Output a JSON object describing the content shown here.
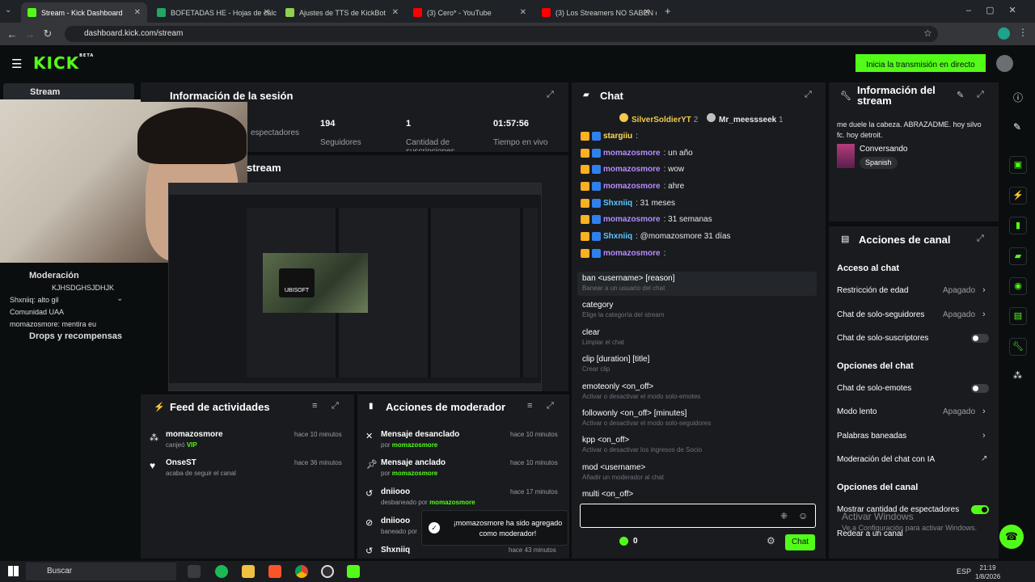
{
  "browser": {
    "tabs": [
      "Stream - Kick Dashboard",
      "BOFETADAS HE - Hojas de cálc",
      "Ajustes de TTS de KickBot",
      "(3) Cero* - YouTube",
      "(3) Los Streamers NO SABEN d"
    ],
    "url": "dashboard.kick.com/stream"
  },
  "header": {
    "logo": "KICK",
    "logo_beta": "BETA",
    "go_live": "Inicia la transmisión en directo"
  },
  "sidebar": {
    "stream": "Stream",
    "chat_lines": [
      "Moderación",
      "KJHSDGHSJDHJK",
      "Shxniiq: alto gil",
      "Comunidad UAA",
      "momazosmore: mentira eu",
      "Drops y recompensas"
    ]
  },
  "session": {
    "title": "Información de la sesión",
    "stats": [
      {
        "value": "",
        "label": "espectadores"
      },
      {
        "value": "194",
        "label": "Seguidores"
      },
      {
        "value": "1",
        "label": "Cantidad de suscripciones"
      },
      {
        "value": "01:57:56",
        "label": "Tiempo en vivo"
      }
    ],
    "preview_title": "stream"
  },
  "feed": {
    "title": "Feed de actividades",
    "items": [
      {
        "user": "momazosmore",
        "action": "canjeó",
        "extra": "VIP",
        "time": "hace 10 minutos"
      },
      {
        "user": "OnseST",
        "action": "acaba de seguir el canal",
        "extra": "",
        "time": "hace 36 minutos"
      }
    ]
  },
  "modactions": {
    "title": "Acciones de moderador",
    "items": [
      {
        "title": "Mensaje desanclado",
        "by": "por",
        "mod": "momazosmore",
        "time": "hace 10 minutos"
      },
      {
        "title": "Mensaje anclado",
        "by": "por",
        "mod": "momazosmore",
        "time": "hace 10 minutos"
      },
      {
        "title": "dniiooo",
        "by": "desbaneado por",
        "mod": "momazosmore",
        "time": "hace 17 minutos"
      },
      {
        "title": "dniiooo",
        "by": "baneado por",
        "mod": "",
        "time": ""
      },
      {
        "title": "Shxniiq",
        "by": "",
        "mod": "",
        "time": "hace 43 minutos"
      }
    ]
  },
  "toast": "¡momazosmore ha sido agregado como moderador!",
  "chat": {
    "title": "Chat",
    "top": [
      {
        "name": "SilverSoldierYT",
        "n": "2"
      },
      {
        "name": "Mr_meessseek",
        "n": "1"
      }
    ],
    "messages": [
      {
        "user": "stargiiu",
        "text": ":",
        "color": "#ffde59"
      },
      {
        "user": "momazosmore",
        "text": ": un año",
        "color": "#b68cff"
      },
      {
        "user": "momazosmore",
        "text": ": wow",
        "color": "#b68cff"
      },
      {
        "user": "momazosmore",
        "text": ": ahre",
        "color": "#b68cff"
      },
      {
        "user": "Shxniiq",
        "text": ": 31 meses",
        "color": "#5cc8ff"
      },
      {
        "user": "momazosmore",
        "text": ": 31 semanas",
        "color": "#b68cff"
      },
      {
        "user": "Shxniiq",
        "text": ": @momazosmore 31 días",
        "color": "#5cc8ff"
      },
      {
        "user": "momazosmore",
        "text": ":",
        "color": "#b68cff"
      }
    ],
    "commands": [
      {
        "cmd": "ban <username> [reason]",
        "desc": "Banear a un usuario del chat"
      },
      {
        "cmd": "category",
        "desc": "Elige la categoría del stream"
      },
      {
        "cmd": "clear",
        "desc": "Limpiar el chat"
      },
      {
        "cmd": "clip [duration] [title]",
        "desc": "Crear clip"
      },
      {
        "cmd": "emoteonly <on_off>",
        "desc": "Activar o desactivar el modo solo-emotes"
      },
      {
        "cmd": "followonly <on_off> [minutes]",
        "desc": "Activar o desactivar el modo solo-seguidores"
      },
      {
        "cmd": "kpp <on_off>",
        "desc": "Activar o desactivar los ingresos de Socio"
      },
      {
        "cmd": "mod <username>",
        "desc": "Añadir un moderador al chat"
      },
      {
        "cmd": "multi <on_off>",
        "desc": ""
      }
    ],
    "points": "0",
    "send": "Chat"
  },
  "streaminfo": {
    "title": "Información del stream",
    "desc": "me duele la cabeza. ABRAZADME. hoy silvo fc. hoy detroit.",
    "category": "Conversando",
    "language": "Spanish"
  },
  "channel": {
    "title": "Acciones de canal",
    "sections": [
      {
        "h": "Acceso al chat"
      },
      {
        "h": "Opciones del chat"
      },
      {
        "h": "Opciones del canal"
      }
    ],
    "rows": [
      "Restricción de edad",
      "Chat de solo-seguidores",
      "Chat de solo-suscriptores",
      "Chat de solo-emotes",
      "Modo lento",
      "Palabras baneadas",
      "Moderación del chat con IA",
      "Mostrar cantidad de espectadores",
      "Redear a un canal"
    ],
    "off": "Apagado",
    "watermark1": "Activar Windows",
    "watermark2": "Ve a Configuración para activar Windows."
  },
  "taskbar": {
    "search": "Buscar",
    "lang": "ESP",
    "time": "21:19",
    "date": "1/8/2026"
  }
}
